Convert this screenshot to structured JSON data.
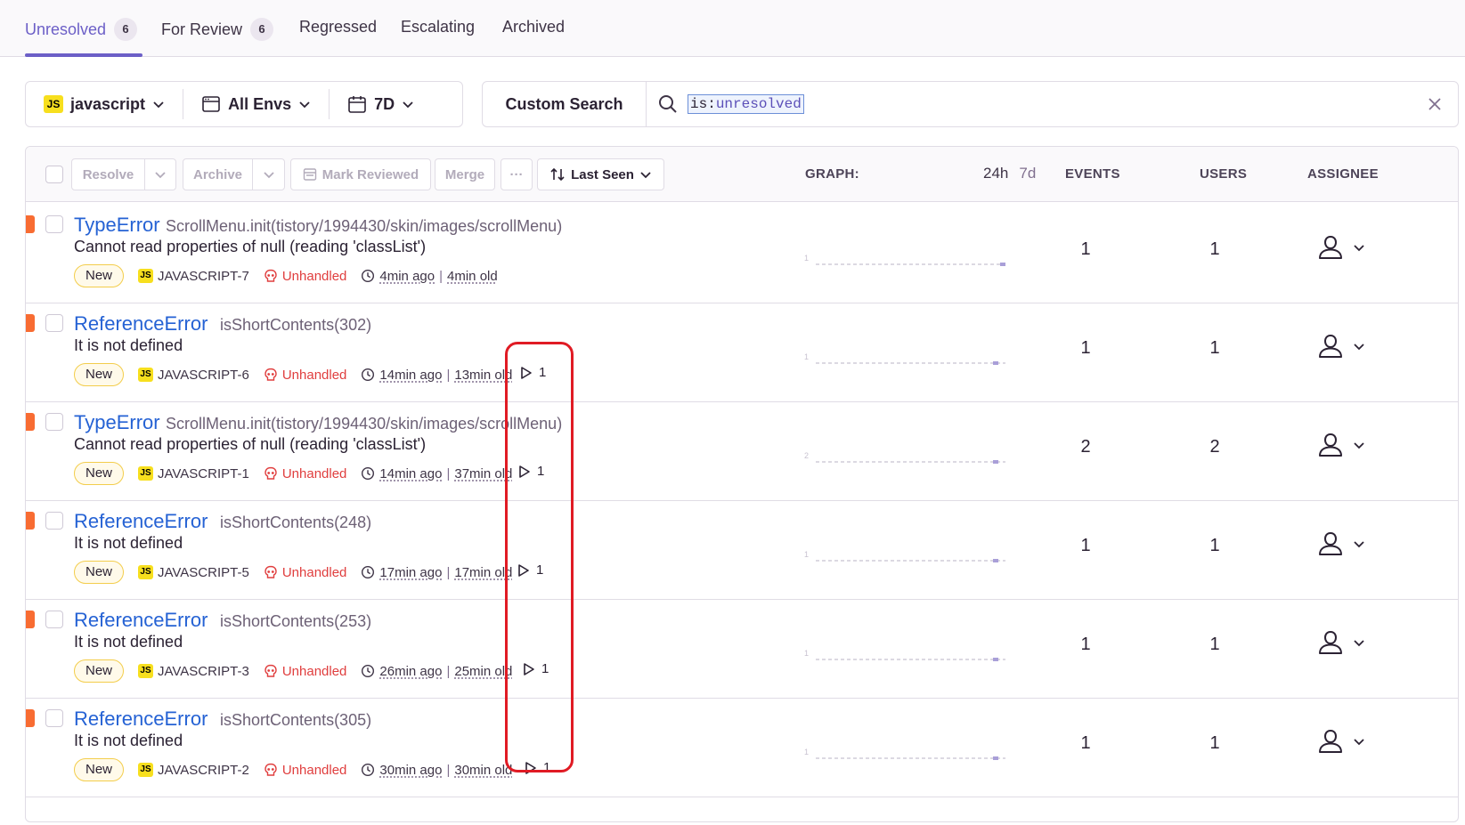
{
  "tabs": [
    {
      "label": "Unresolved",
      "count": "6",
      "active": true
    },
    {
      "label": "For Review",
      "count": "6"
    },
    {
      "label": "Regressed"
    },
    {
      "label": "Escalating"
    },
    {
      "label": "Archived"
    }
  ],
  "filters": {
    "project_badge": "JS",
    "project": "javascript",
    "environment": "All Envs",
    "date_range": "7D"
  },
  "search": {
    "custom_search_label": "Custom Search",
    "token_key": "is:",
    "token_value": "unresolved"
  },
  "toolbar": {
    "resolve": "Resolve",
    "archive": "Archive",
    "mark_reviewed": "Mark Reviewed",
    "merge": "Merge",
    "more": "···",
    "sort": "Last Seen"
  },
  "columns": {
    "graph": "GRAPH:",
    "range_24h": "24h",
    "range_7d": "7d",
    "events": "EVENTS",
    "users": "USERS",
    "assignee": "ASSIGNEE"
  },
  "issues": [
    {
      "type": "TypeError",
      "culprit": "ScrollMenu.init(tistory/1994430/skin/images/scrollMenu)",
      "message": "Cannot read properties of null (reading 'classList')",
      "badge": "New",
      "js": "JS",
      "short_id": "JAVASCRIPT-7",
      "mechanism": "Unhandled",
      "last_seen": "4min ago",
      "sep": "|",
      "first_seen": "4min old",
      "replays": "",
      "graph_max": "1",
      "events": "1",
      "users": "1"
    },
    {
      "type": "ReferenceError",
      "culprit": "isShortContents(302)",
      "message": "It is not defined",
      "badge": "New",
      "js": "JS",
      "short_id": "JAVASCRIPT-6",
      "mechanism": "Unhandled",
      "last_seen": "14min ago",
      "sep": "|",
      "first_seen": "13min old",
      "replays": "1",
      "graph_max": "1",
      "events": "1",
      "users": "1"
    },
    {
      "type": "TypeError",
      "culprit": "ScrollMenu.init(tistory/1994430/skin/images/scrollMenu)",
      "message": "Cannot read properties of null (reading 'classList')",
      "badge": "New",
      "js": "JS",
      "short_id": "JAVASCRIPT-1",
      "mechanism": "Unhandled",
      "last_seen": "14min ago",
      "sep": "|",
      "first_seen": "37min old",
      "replays": "1",
      "graph_max": "2",
      "events": "2",
      "users": "2"
    },
    {
      "type": "ReferenceError",
      "culprit": "isShortContents(248)",
      "message": "It is not defined",
      "badge": "New",
      "js": "JS",
      "short_id": "JAVASCRIPT-5",
      "mechanism": "Unhandled",
      "last_seen": "17min ago",
      "sep": "|",
      "first_seen": "17min old",
      "replays": "1",
      "graph_max": "1",
      "events": "1",
      "users": "1"
    },
    {
      "type": "ReferenceError",
      "culprit": "isShortContents(253)",
      "message": "It is not defined",
      "badge": "New",
      "js": "JS",
      "short_id": "JAVASCRIPT-3",
      "mechanism": "Unhandled",
      "last_seen": "26min ago",
      "sep": "|",
      "first_seen": "25min old",
      "replays": "1",
      "graph_max": "1",
      "events": "1",
      "users": "1"
    },
    {
      "type": "ReferenceError",
      "culprit": "isShortContents(305)",
      "message": "It is not defined",
      "badge": "New",
      "js": "JS",
      "short_id": "JAVASCRIPT-2",
      "mechanism": "Unhandled",
      "last_seen": "30min ago",
      "sep": "|",
      "first_seen": "30min old",
      "replays": "1",
      "graph_max": "1",
      "events": "1",
      "users": "1"
    }
  ],
  "colors": {
    "accent": "#6c5fc7",
    "link": "#2562d4",
    "error_level": "#f86c32",
    "unhandled": "#e03e3e",
    "highlight_box": "#e01b24"
  }
}
